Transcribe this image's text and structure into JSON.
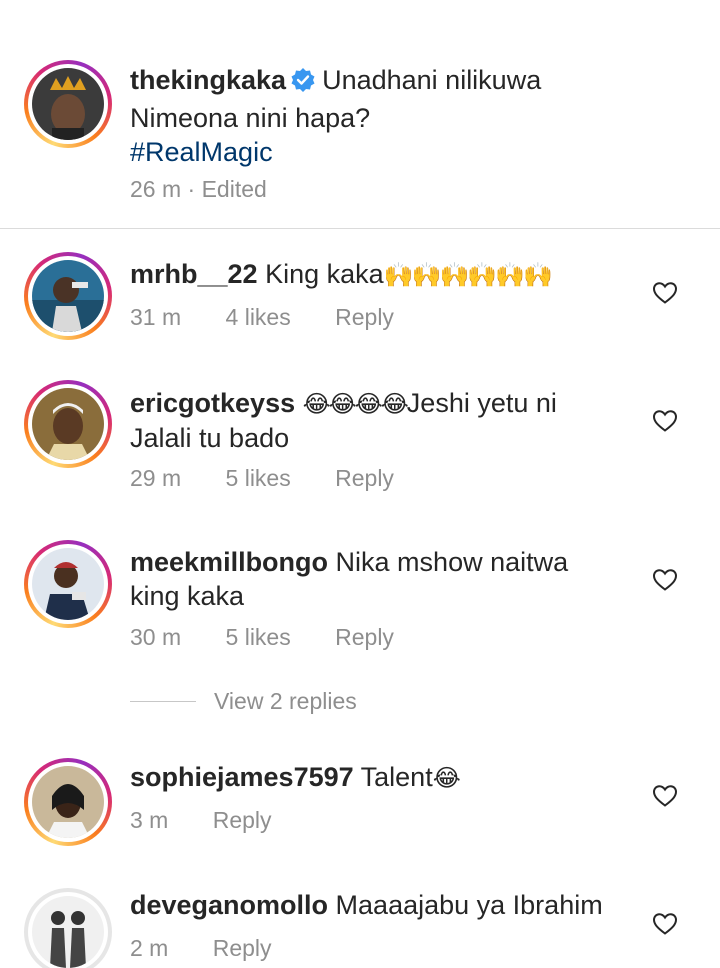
{
  "post": {
    "username": "thekingkaka",
    "caption_line1": "Unadhani nilikuwa",
    "caption_line2": "Nimeona nini hapa?",
    "hashtag": "#RealMagic",
    "time": "26 m",
    "separator": "·",
    "edited": "Edited"
  },
  "comments": [
    {
      "username": "mrhb__22",
      "text": "King kaka",
      "emoji": "🙌🙌🙌🙌🙌🙌",
      "time": "31 m",
      "likes": "4 likes",
      "reply": "Reply"
    },
    {
      "username": "ericgotkeyss",
      "emoji": "😂😂😂😂",
      "text": "Jeshi yetu ni",
      "text_line2": "Jalali tu bado",
      "time": "29 m",
      "likes": "5 likes",
      "reply": "Reply"
    },
    {
      "username": "meekmillbongo",
      "text": "Nika mshow naitwa",
      "text_line2": "king kaka",
      "time": "30 m",
      "likes": "5 likes",
      "reply": "Reply"
    },
    {
      "username": "sophiejames7597",
      "text": "Talent",
      "emoji": "😂",
      "time": "3 m",
      "reply": "Reply"
    },
    {
      "username": "deveganomollo",
      "text": "Maaaajabu ya Ibrahim",
      "time": "2 m",
      "reply": "Reply"
    }
  ],
  "view_replies": "View 2 replies",
  "icons": {
    "verified": "verified-badge-icon",
    "like": "heart-outline-icon"
  },
  "colors": {
    "verified": "#3897f0",
    "hashtag": "#00376b",
    "meta": "#8e8e8e"
  }
}
